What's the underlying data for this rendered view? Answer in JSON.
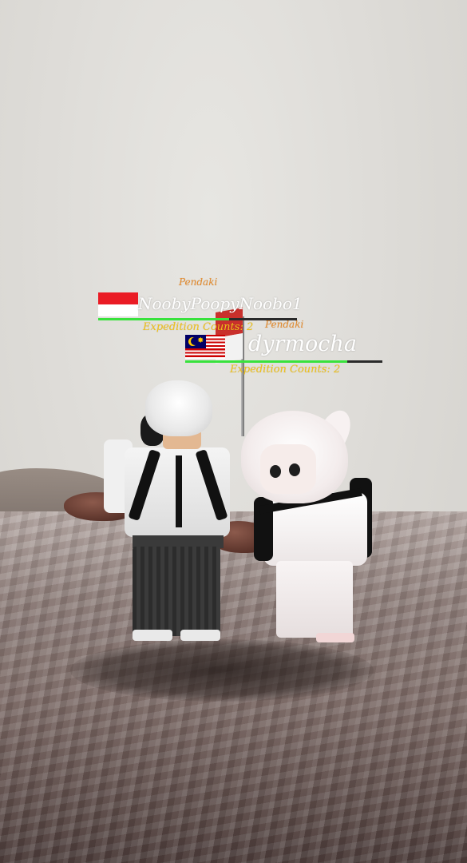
{
  "scene": {
    "colors": {
      "sky": "#dedcd8",
      "ground": "#7b6a66",
      "rank": "#e58a2a",
      "counts": "#f0c21a",
      "hp": "#38e23c"
    }
  },
  "players": [
    {
      "rank": "Pendaki",
      "flag": "indonesia-flag-icon",
      "username": "NoobyPoopyNoobo1",
      "health_fraction": 0.66,
      "expedition_counts": "Expedition Counts: 2"
    },
    {
      "rank": "Pendaki",
      "flag": "malaysia-flag-icon",
      "username": "dyrmocha",
      "health_fraction": 0.82,
      "expedition_counts": "Expedition Counts: 2"
    }
  ]
}
